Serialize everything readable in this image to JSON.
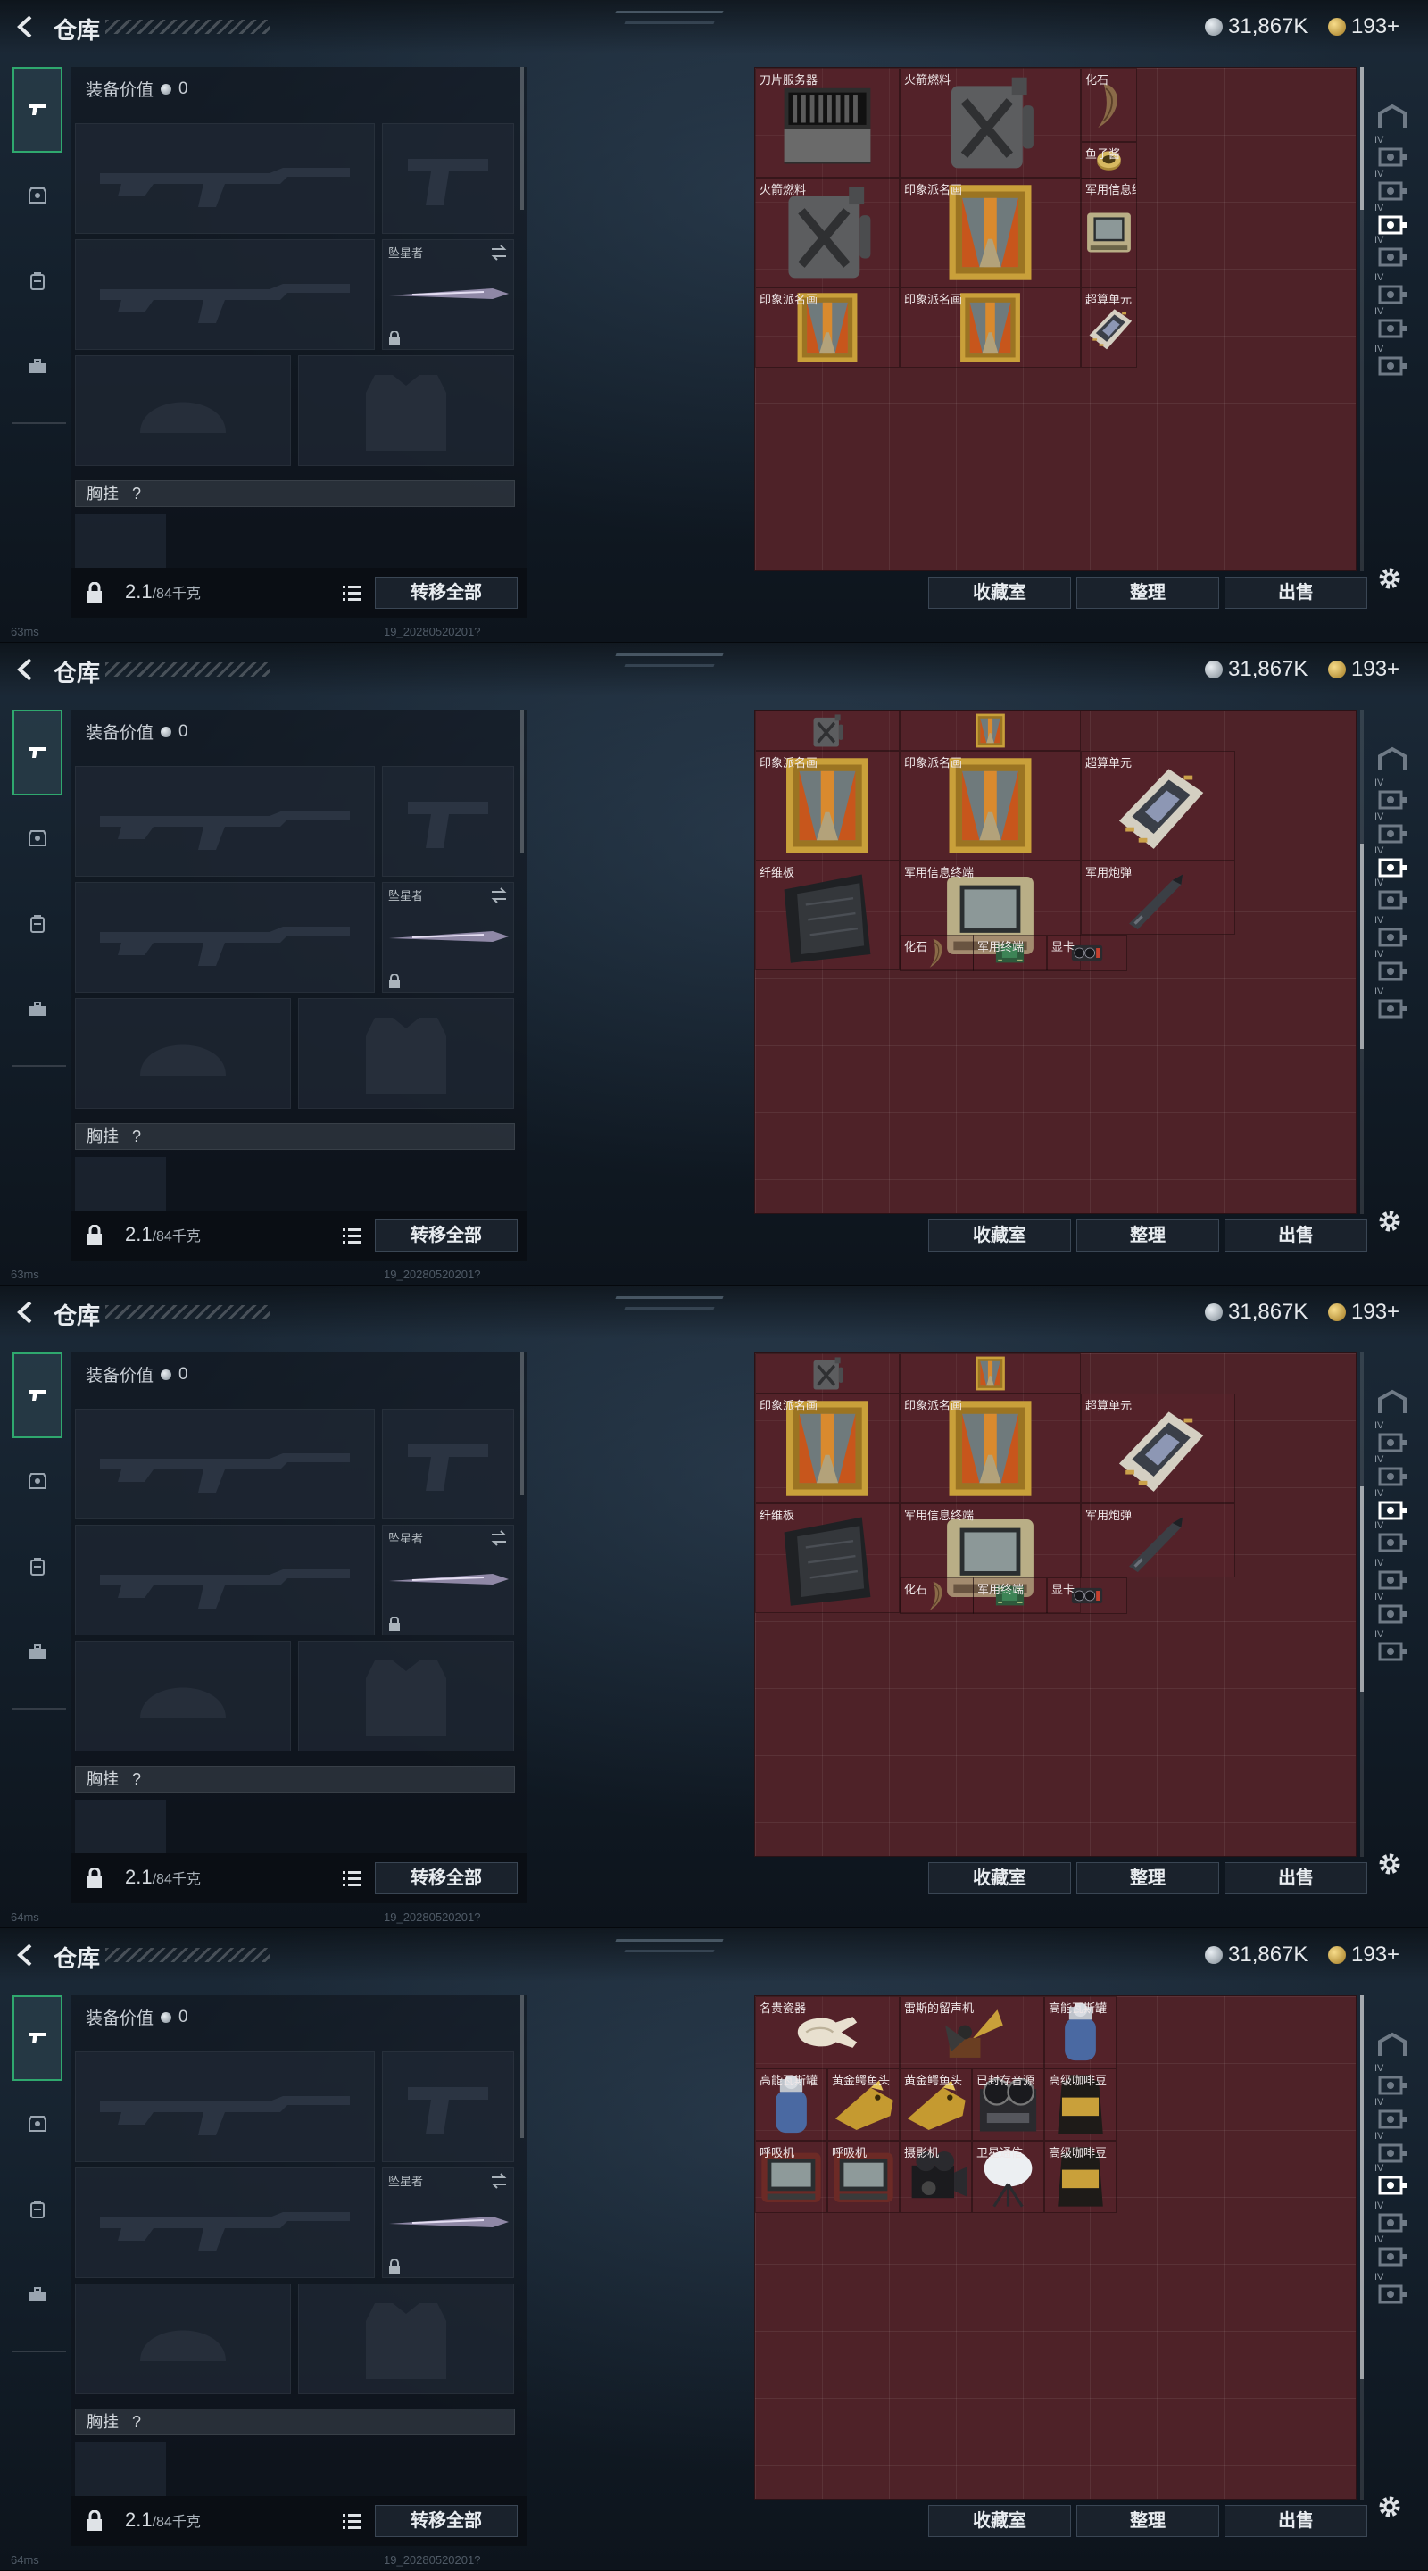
{
  "title": "仓库",
  "currency": {
    "silver": "31,867K",
    "gold": "193+"
  },
  "loadout": {
    "equip_value_label": "装备价值",
    "equip_value": "0",
    "melee_label": "坠星者",
    "chest_rig_label": "胸挂",
    "chest_rig_help": "?",
    "weight": "2.1",
    "weight_capacity": "/84千克",
    "transfer_all": "转移全部"
  },
  "stash_buttons": {
    "collection": "收藏室",
    "sort": "整理",
    "sell": "出售"
  },
  "right_rail_badges": [
    "IV",
    "IV",
    "IV",
    "IV",
    "IV",
    "IV",
    "IV",
    "IV"
  ],
  "status": {
    "ping_1": "63ms",
    "ping_2": "63ms",
    "ping_3": "64ms",
    "ping_4": "64ms",
    "build": "19_20280520201?"
  },
  "panels": [
    {
      "items": [
        {
          "label": "刀片服务器",
          "icon": "blade-server"
        },
        {
          "label": "火箭燃料",
          "icon": "fuel-can"
        },
        {
          "label": "化石",
          "icon": "fossil-claw"
        },
        {
          "label": "鱼子酱",
          "icon": "caviar-tin"
        },
        {
          "label": "火箭燃料",
          "icon": "fuel-can"
        },
        {
          "label": "印象派名画",
          "icon": "painting"
        },
        {
          "label": "军用信息终端",
          "icon": "military-terminal"
        },
        {
          "label": "印象派名画",
          "icon": "painting"
        },
        {
          "label": "印象派名画",
          "icon": "painting"
        },
        {
          "label": "超算单元",
          "icon": "supercomputer-unit"
        }
      ]
    },
    {
      "items": [
        {
          "label": "",
          "icon": "fuel-can"
        },
        {
          "label": "",
          "icon": "painting"
        },
        {
          "label": "印象派名画",
          "icon": "painting"
        },
        {
          "label": "印象派名画",
          "icon": "painting"
        },
        {
          "label": "超算单元",
          "icon": "supercomputer-unit"
        },
        {
          "label": "纤维板",
          "icon": "fiber-board"
        },
        {
          "label": "军用信息终端",
          "icon": "military-terminal"
        },
        {
          "label": "军用炮弹",
          "icon": "artillery-shell"
        },
        {
          "label": "化石",
          "icon": "fossil-claw"
        },
        {
          "label": "军用终端",
          "icon": "circuit-board"
        },
        {
          "label": "显卡",
          "icon": "graphics-card"
        }
      ]
    },
    {
      "items": [
        {
          "label": "",
          "icon": "fuel-can"
        },
        {
          "label": "",
          "icon": "painting"
        },
        {
          "label": "印象派名画",
          "icon": "painting"
        },
        {
          "label": "印象派名画",
          "icon": "painting"
        },
        {
          "label": "超算单元",
          "icon": "supercomputer-unit"
        },
        {
          "label": "纤维板",
          "icon": "fiber-board"
        },
        {
          "label": "军用信息终端",
          "icon": "military-terminal"
        },
        {
          "label": "军用炮弹",
          "icon": "artillery-shell"
        },
        {
          "label": "化石",
          "icon": "fossil-claw"
        },
        {
          "label": "军用终端",
          "icon": "circuit-board"
        },
        {
          "label": "显卡",
          "icon": "graphics-card"
        }
      ]
    },
    {
      "items": [
        {
          "label": "名贵瓷器",
          "icon": "porcelain-vase"
        },
        {
          "label": "雷斯的留声机",
          "icon": "gramophone"
        },
        {
          "label": "高能瓦斯罐",
          "icon": "gas-canister"
        },
        {
          "label": "高能瓦斯罐",
          "icon": "gas-canister"
        },
        {
          "label": "黄金鳄鱼头",
          "icon": "gold-croc-head"
        },
        {
          "label": "黄金鳄鱼头",
          "icon": "gold-croc-head"
        },
        {
          "label": "已封存音源",
          "icon": "reel-recorder"
        },
        {
          "label": "高级咖啡豆",
          "icon": "coffee-beans"
        },
        {
          "label": "呼吸机",
          "icon": "ventilator"
        },
        {
          "label": "呼吸机",
          "icon": "ventilator"
        },
        {
          "label": "摄影机",
          "icon": "film-camera"
        },
        {
          "label": "卫星通信",
          "icon": "satellite-dish"
        },
        {
          "label": "高级咖啡豆",
          "icon": "coffee-beans"
        }
      ]
    }
  ]
}
